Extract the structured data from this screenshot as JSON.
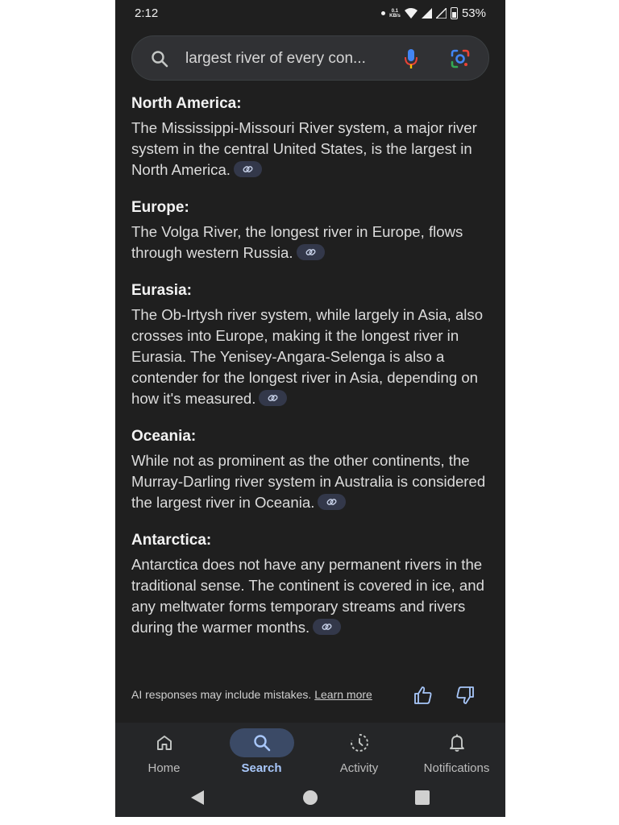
{
  "status_bar": {
    "time": "2:12",
    "kbs_top": "0.1",
    "kbs_bottom": "KB/s",
    "battery": "53%"
  },
  "search": {
    "query": "largest river of every con..."
  },
  "sections": [
    {
      "heading": "North America:",
      "text": "The Mississippi-Missouri River system, a major river system in the central United States, is the largest in North America."
    },
    {
      "heading": "Europe:",
      "text": "The Volga River, the longest river in Europe, flows through western Russia."
    },
    {
      "heading": "Eurasia:",
      "text": "The Ob-Irtysh river system, while largely in Asia, also crosses into Europe, making it the longest river in Eurasia. The Yenisey-Angara-Selenga is also a contender for the longest river in Asia, depending on how it's measured."
    },
    {
      "heading": "Oceania:",
      "text": "While not as prominent as the other continents, the Murray-Darling river system in Australia is considered the largest river in Oceania."
    },
    {
      "heading": "Antarctica:",
      "text": "Antarctica does not have any permanent rivers in the traditional sense. The continent is covered in ice, and any meltwater forms temporary streams and rivers during the warmer months."
    }
  ],
  "footer": {
    "disclaimer": "AI responses may include mistakes.",
    "learn_more": "Learn more"
  },
  "nav": {
    "items": [
      {
        "label": "Home",
        "icon": "home-icon"
      },
      {
        "label": "Search",
        "icon": "search-icon"
      },
      {
        "label": "Activity",
        "icon": "activity-icon"
      },
      {
        "label": "Notifications",
        "icon": "bell-icon"
      }
    ],
    "active": "Search"
  },
  "colors": {
    "background": "#1f1f1f",
    "accent": "#a8c7fa",
    "active_pill": "#3b4a66"
  }
}
